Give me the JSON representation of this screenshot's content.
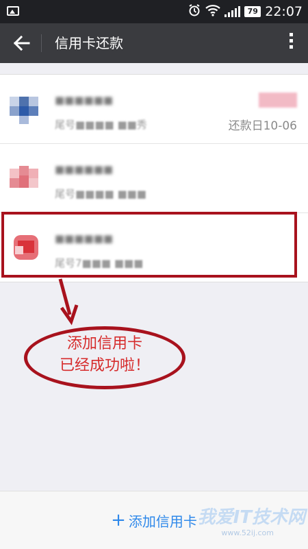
{
  "status_bar": {
    "battery": "79",
    "time": "22:07"
  },
  "app_bar": {
    "title": "信用卡还款"
  },
  "cards": [
    {
      "name": "■■■■■■",
      "tail": "尾号■■■■ ■■秀",
      "due_date": "还款日10-06",
      "logo_color": "#2d5aa8"
    },
    {
      "name": "■■■■■■",
      "tail": "尾号■■■■ ■■■",
      "due_date": "",
      "logo_color": "#e0707a"
    },
    {
      "name": "■■■■■■",
      "tail": "尾号7■■■ ■■■",
      "due_date": "",
      "logo_color": "#d9323a"
    }
  ],
  "annotation": {
    "line1": "添加信用卡",
    "line2": "已经成功啦！"
  },
  "bottom_bar": {
    "add_label": "添加信用卡"
  },
  "watermark": {
    "text": "我爱IT技术网",
    "url": "www.52ij.com"
  },
  "colors": {
    "accent": "#2e88ea",
    "annotation_red": "#a8121d"
  }
}
